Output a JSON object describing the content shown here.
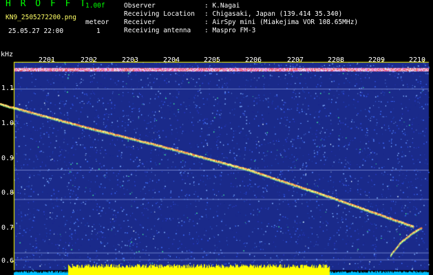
{
  "header": {
    "app_title": "H R O F F T",
    "version": "1.00f",
    "filename": "KN9_2505272200.png",
    "datetime": "25.05.27 22:00",
    "meteor_label": "meteor",
    "meteor_count": "1",
    "fields": [
      {
        "label": "Observer",
        "value": ": K.Nagai"
      },
      {
        "label": "Receiving Location",
        "value": ": Chigasaki, Japan (139.414 35.340)"
      },
      {
        "label": "Receiver",
        "value": ": AirSpy mini (Miakejima VOR 108.65MHz)"
      },
      {
        "label": "Receiving antenna",
        "value": ": Maspro FM-3"
      }
    ]
  },
  "chart_data": {
    "type": "heatmap",
    "ylabel": "kHz",
    "x_ticks": [
      "2201",
      "2202",
      "2203",
      "2204",
      "2205",
      "2206",
      "2207",
      "2208",
      "2209",
      "2210"
    ],
    "y_ticks": [
      "1.1",
      "1.0",
      "0.9",
      "0.8",
      "0.7",
      "0.6"
    ],
    "ylim": [
      0.58,
      1.18
    ],
    "carrier_khz": 1.156,
    "traces": [
      {
        "name": "main",
        "x": [
          2200.0,
          2202.0,
          2204.0,
          2206.0,
          2208.0,
          2210.0
        ],
        "y": [
          1.055,
          0.99,
          0.93,
          0.865,
          0.785,
          0.7
        ]
      },
      {
        "name": "hook",
        "x": [
          2209.45,
          2209.7,
          2210.0,
          2210.2
        ],
        "y": [
          0.617,
          0.655,
          0.683,
          0.697
        ]
      }
    ],
    "colors": {
      "background": "#1a2a8a",
      "trace": "#ffff80",
      "carrier": "#ff6060",
      "signal_bar": "#ffff00",
      "noise_bar": "#00c0ff",
      "frame": "#ffff00"
    }
  }
}
